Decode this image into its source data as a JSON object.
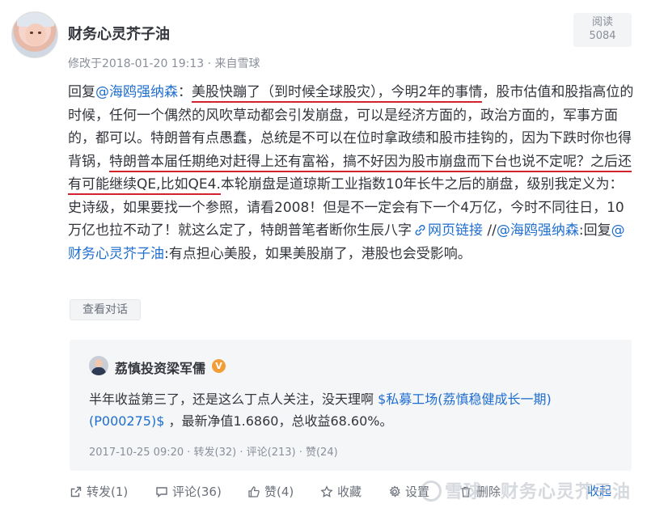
{
  "post": {
    "author": "财务心灵芥子油",
    "meta": "修改于2018-01-20 19:13 · 来自雪球",
    "read_label": "阅读",
    "read_count": "5084"
  },
  "content": {
    "s1": "回复",
    "mention1": "@海鸥强纳森",
    "s2": "：",
    "u1": "美股快蹦了（到时候全球股灾），今明2年的事情",
    "s3": "，股市估值和股指高位的时候，任何一个偶然的风吹草动都会引发崩盘，可以是经济方面的，政治方面的，军事方面的，都可以。特朗普有点愚蠢，总统是不可以在位时拿政绩和股市挂钩的，因为下跌时你也得背锅，",
    "u2": "特朗普本届任期绝对赶得上还有富裕，搞不好因为股市崩盘而下台也说不定呢？之后还有可能继续QE,比如QE4.",
    "s4": "本轮崩盘是道琼斯工业指数10年长牛之后的崩盘，级别我定义为：史诗级，如果要找一个参照，请看2008！但是不一定会有下一个4万亿，今时不同往日，10万亿也拉不动了！就这么定了，特朗普笔者断你生辰八字",
    "weblink": "网页链接",
    "s5": " //",
    "mention2": "@海鸥强纳森",
    "s6": ":回复",
    "mention3": "@财务心灵芥子油",
    "s7": ":有点担心美股，如果美股崩了，港股也会受影响。"
  },
  "convo_button": "查看对话",
  "quote": {
    "author": "荔慎投资梁军儒",
    "badge": "V",
    "t1": "半年收益第三了，还是这么丁点人关注，没天理啊 ",
    "fund_link": "$私募工场(荔慎稳健成长一期)(P000275)$",
    "t2": " ，最新净值1.6860，总收益68.60%。",
    "meta": "2017-10-25 09:20 · 转发(32) · 评论(213) · 赞(24)"
  },
  "actions": {
    "forward": "转发(1)",
    "comment": "评论(36)",
    "like": "赞(4)",
    "favorite": "收藏",
    "settings": "设置",
    "delete": "删除",
    "collapse": "收起"
  },
  "watermark": "雪球：财务心灵芥子油",
  "colors": {
    "link": "#1f6ecf",
    "underline": "#d4232c",
    "badge": "#f19d38"
  }
}
